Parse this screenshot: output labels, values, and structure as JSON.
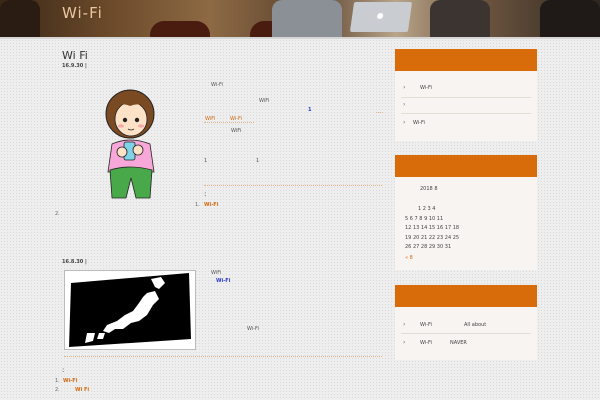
{
  "site": {
    "title": "Wi-Fi"
  },
  "posts": [
    {
      "title": "Wi Fi",
      "date": "16.9.30",
      "date_sep": "|",
      "body": {
        "l1": "Wi-Fi",
        "l2": "WiFi",
        "l3_num": "1",
        "l4a": "WiFi",
        "l4b": "Wi-Fi",
        "l5": "WiFi",
        "l6a": "1",
        "l6b": "1"
      },
      "related_title": ":",
      "related": [
        {
          "num": "1.",
          "label": "Wi-Fi"
        }
      ],
      "extra_num": "2."
    },
    {
      "title": "",
      "date": "16.8.30",
      "date_sep": "|",
      "body": {
        "l1": "WiFi",
        "l2": "Wi-Fi",
        "l3": "Wi-Fi"
      },
      "related_title": ":",
      "related": [
        {
          "num": "1.",
          "label": "Wi-Fi"
        },
        {
          "num": "2.",
          "label": "Wi Fi"
        }
      ]
    }
  ],
  "sidebar": {
    "widget1": {
      "heading": "",
      "items": [
        "Wi-Fi",
        "",
        "Wi-Fi"
      ],
      "chevron": "›"
    },
    "widget2": {
      "heading": "",
      "calendar": {
        "month": "2018 8",
        "rows": [
          "1 2 3 4",
          "5 6 7 8 9 10 11",
          "12 13 14 15 16 17 18",
          "19 20 21 22 23 24 25",
          "26 27 28 29 30 31"
        ],
        "prev": "« 8"
      }
    },
    "widget3": {
      "heading": "",
      "items": [
        {
          "a": "Wi-Fi",
          "b": "All about"
        },
        {
          "a": "Wi-Fi",
          "b": "NAVER"
        }
      ],
      "chevron": "›"
    }
  },
  "colors": {
    "accent": "#d96c0a",
    "link": "#d06a10",
    "link_blue": "#2b3bc8"
  }
}
